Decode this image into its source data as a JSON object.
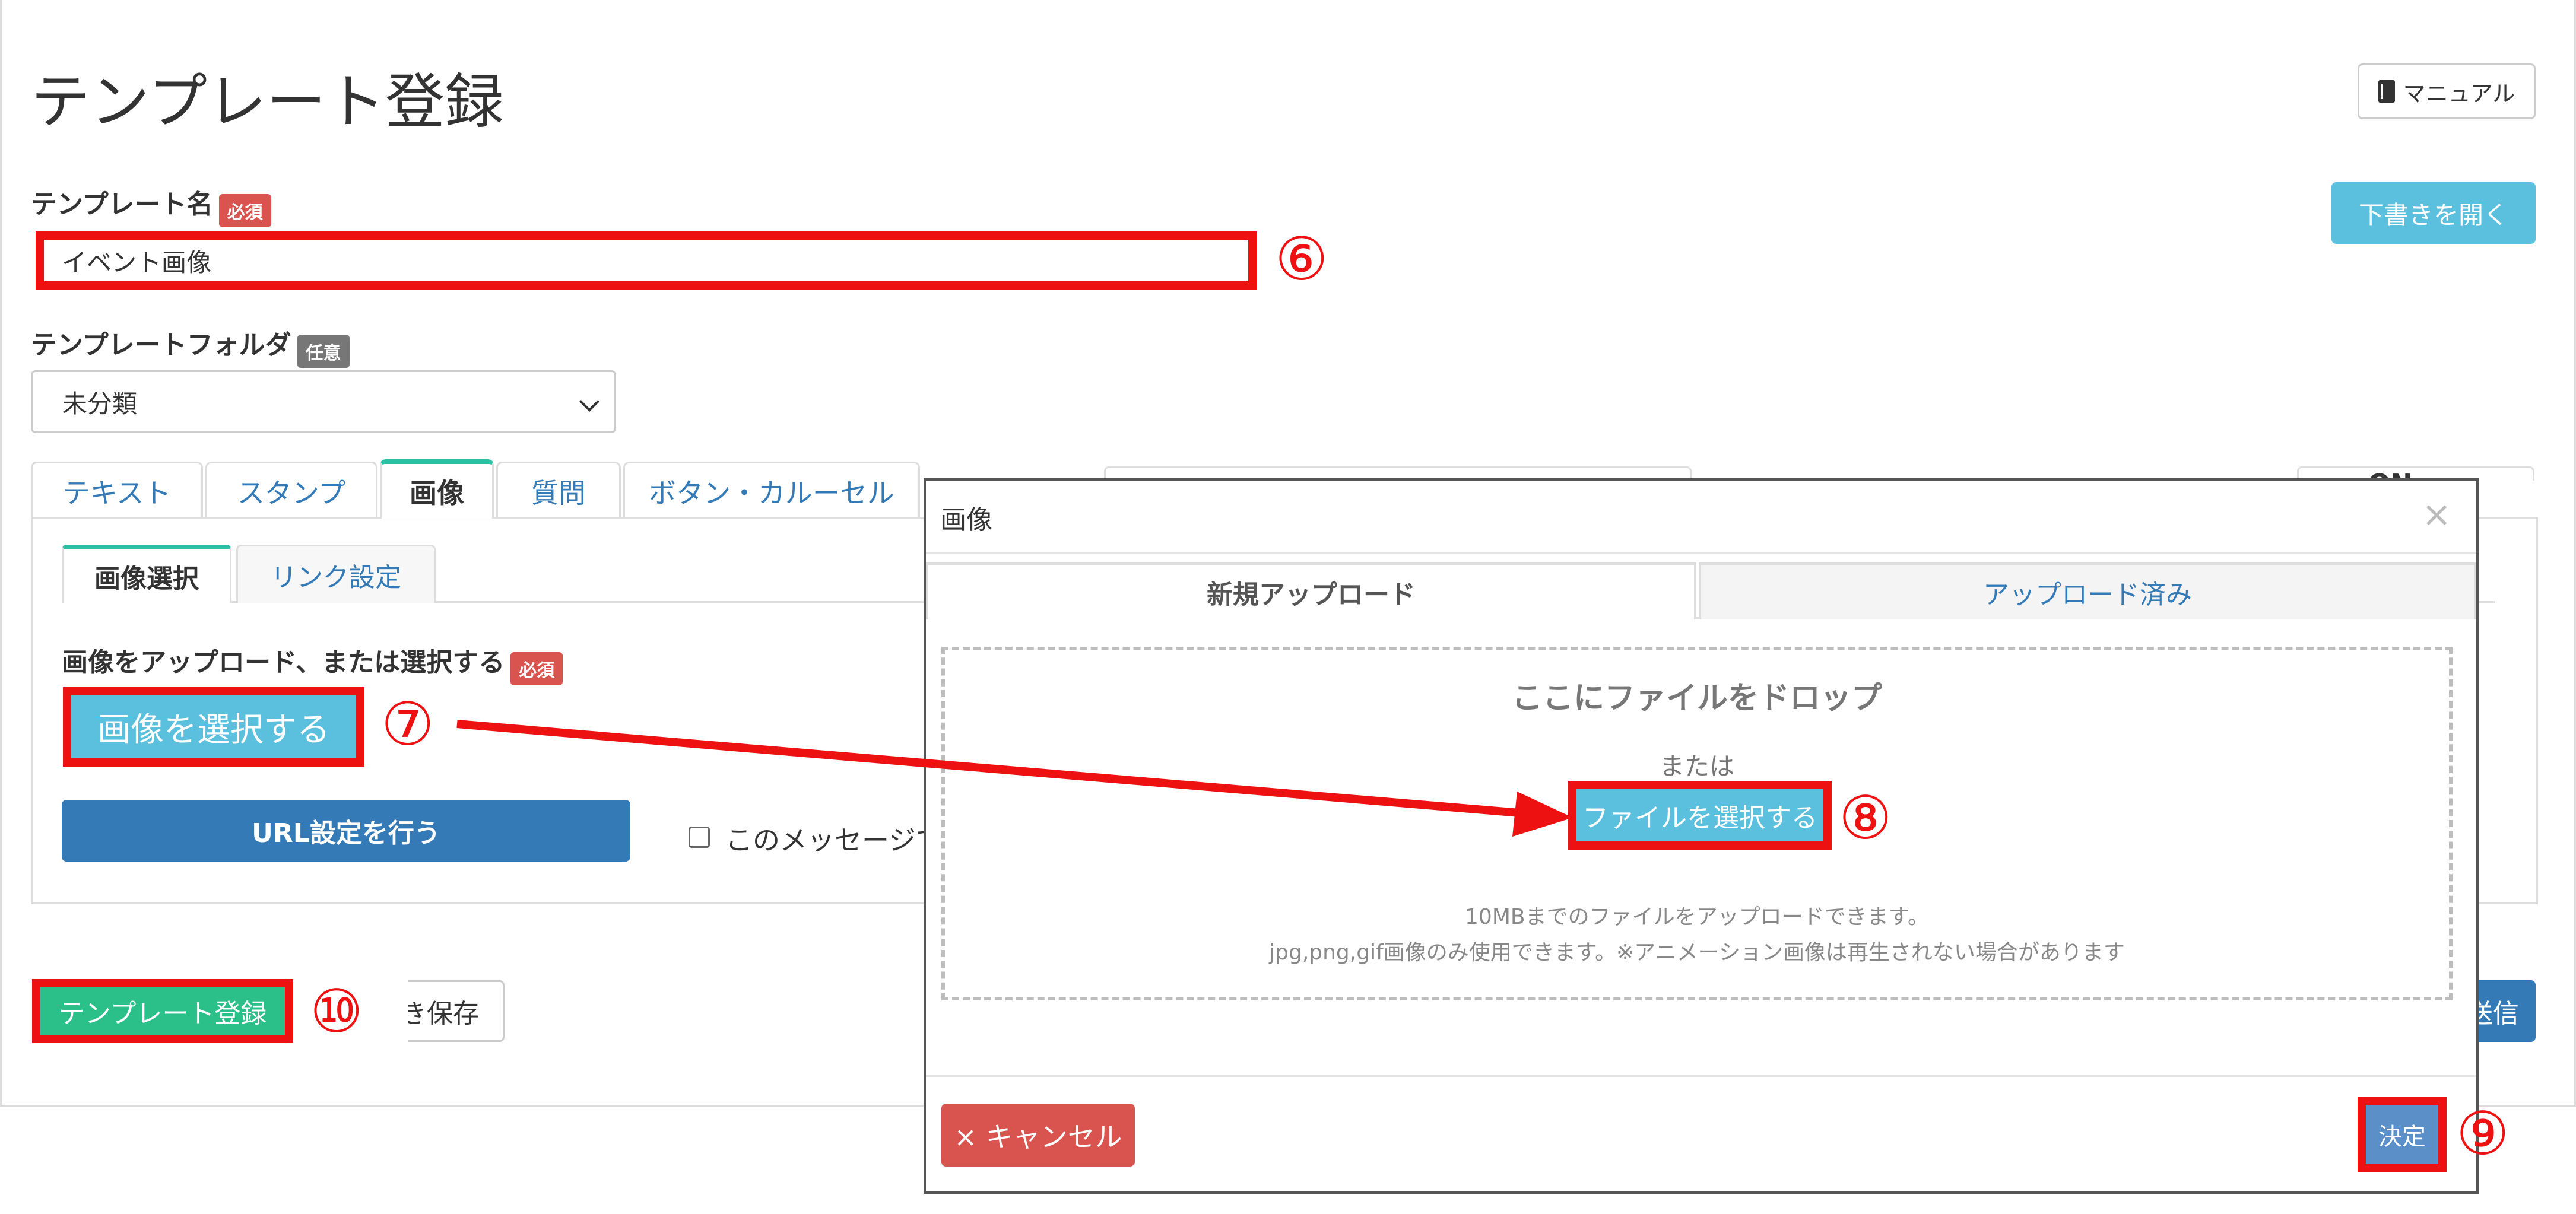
{
  "page": {
    "title": "テンプレート登録",
    "manual_label": "マニュアル",
    "draft_button": "下書きを開く"
  },
  "form": {
    "name_label": "テンプレート名",
    "required_badge": "必須",
    "name_value": "イベント画像",
    "folder_label": "テンプレートフォルダ",
    "optional_badge": "任意",
    "folder_value": "未分類"
  },
  "tabs": [
    "テキスト",
    "スタンプ",
    "画像",
    "質問",
    "ボタン・カルーセル"
  ],
  "tabs_right_partial": "ON",
  "subtabs": [
    "画像選択",
    "リンク設定"
  ],
  "image_section": {
    "label": "画像をアップロード、または選択する",
    "select_button": "画像を選択する",
    "url_button": "URL設定を行う",
    "checkbox_label": "このメッセージで"
  },
  "footer": {
    "register_button": "テンプレート登録",
    "save_button": "き保存",
    "send_button": "送信"
  },
  "modal": {
    "title": "画像",
    "close_icon": "×",
    "tabs": [
      "新規アップロード",
      "アップロード済み"
    ],
    "drop_title": "ここにファイルをドロップ",
    "or_text": "または",
    "file_button": "ファイルを選択する",
    "info_line1": "10MBまでのファイルをアップロードできます。",
    "info_line2": "jpg,png,gif画像のみ使用できます。※アニメーション画像は再生されない場合があります",
    "cancel_button": "× キャンセル",
    "ok_button": "決定"
  },
  "annotations": [
    "⑥",
    "⑦",
    "⑧",
    "⑨",
    "⑩"
  ],
  "colors": {
    "highlight": "#ee1111",
    "accent_teal": "#2bbfa4",
    "info_blue": "#5bc0de",
    "primary_blue": "#337ab7",
    "danger_red": "#d9534f"
  }
}
